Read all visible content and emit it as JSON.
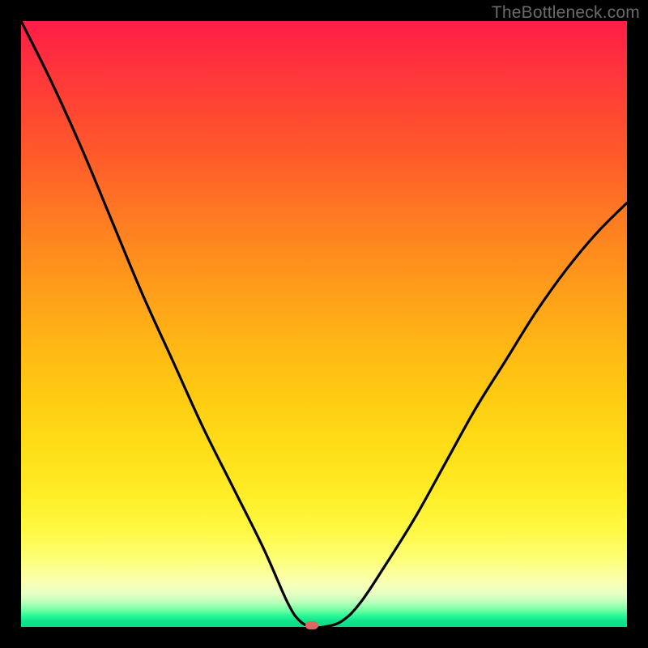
{
  "watermark": "TheBottleneck.com",
  "chart_data": {
    "type": "line",
    "title": "",
    "xlabel": "",
    "ylabel": "",
    "xlim": [
      0,
      100
    ],
    "ylim": [
      0,
      100
    ],
    "series": [
      {
        "name": "bottleneck-curve",
        "x": [
          0,
          5,
          10,
          15,
          20,
          25,
          30,
          35,
          40,
          44,
          46,
          48,
          50,
          53,
          56,
          60,
          65,
          70,
          75,
          80,
          85,
          90,
          95,
          100
        ],
        "y": [
          100,
          90,
          79,
          67,
          55,
          44,
          33,
          23,
          13,
          4,
          1,
          0,
          0,
          1,
          4,
          10,
          18,
          27,
          36,
          44,
          52,
          59,
          65,
          70
        ]
      }
    ],
    "annotations": [
      {
        "name": "optimal-marker",
        "x": 48,
        "y": 0
      }
    ],
    "background": {
      "type": "vertical-gradient",
      "stops": [
        {
          "pos": 0.0,
          "color": "#ff1c47"
        },
        {
          "pos": 0.5,
          "color": "#ffb814"
        },
        {
          "pos": 0.85,
          "color": "#fff843"
        },
        {
          "pos": 1.0,
          "color": "#0fd986"
        }
      ]
    }
  },
  "marker": {
    "color": "#d96a5f"
  }
}
